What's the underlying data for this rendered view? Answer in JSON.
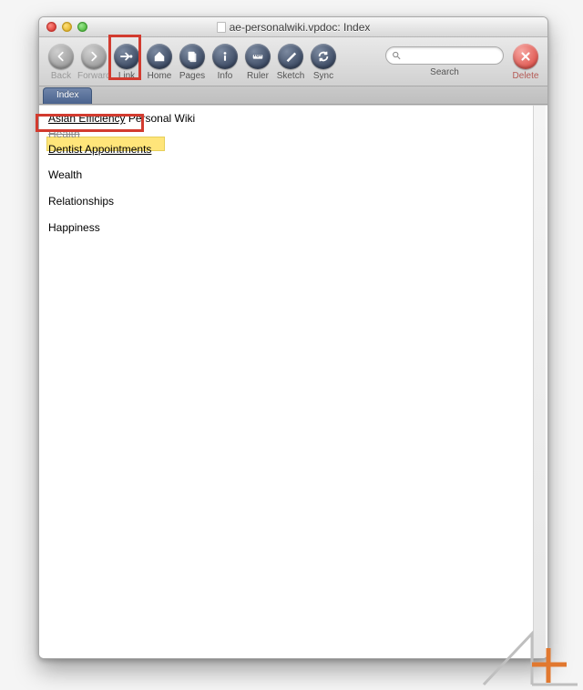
{
  "window": {
    "title": "ae-personalwiki.vpdoc: Index"
  },
  "toolbar": {
    "back": "Back",
    "forward": "Forward",
    "link": "Link",
    "home": "Home",
    "pages": "Pages",
    "info": "Info",
    "ruler": "Ruler",
    "sketch": "Sketch",
    "sync": "Sync",
    "search_label": "Search",
    "delete": "Delete",
    "search_placeholder": ""
  },
  "tab": {
    "label": "Index"
  },
  "content": {
    "heading_linked": "Asian Efficiency",
    "heading_rest": " Personal Wiki",
    "line_health": "Health",
    "line_dentist": "Dentist Appointments",
    "sections": [
      "Wealth",
      "Relationships",
      "Happiness"
    ]
  }
}
